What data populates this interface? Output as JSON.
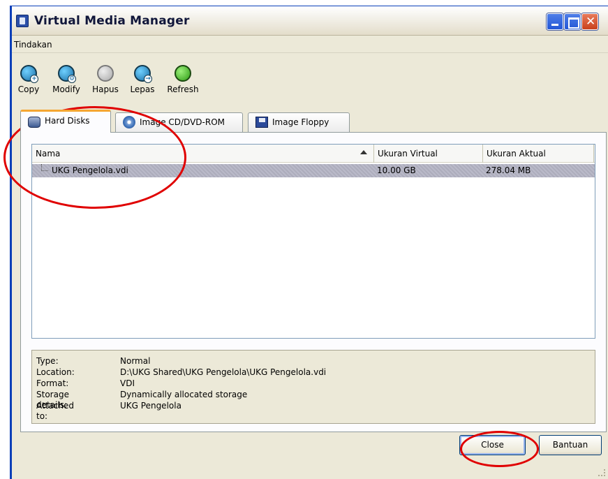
{
  "window": {
    "title": "Virtual Media Manager"
  },
  "menu": {
    "items": [
      "Tindakan"
    ]
  },
  "toolbar": {
    "copy": "Copy",
    "modify": "Modify",
    "hapus": "Hapus",
    "lepas": "Lepas",
    "refresh": "Refresh"
  },
  "tabs": [
    {
      "label": "Hard Disks",
      "icon": "hard-disk-icon",
      "active": true
    },
    {
      "label": "Image CD/DVD-ROM",
      "icon": "cd-dvd-icon",
      "active": false
    },
    {
      "label": "Image Floppy",
      "icon": "floppy-icon",
      "active": false
    }
  ],
  "list": {
    "columns": [
      "Nama",
      "Ukuran Virtual",
      "Ukuran Aktual"
    ],
    "sort_column": "Nama",
    "sort_direction": "ascending",
    "rows": [
      {
        "name": "UKG Pengelola.vdi",
        "virtual_size": "10.00 GB",
        "actual_size": "278.04 MB",
        "selected": true
      }
    ]
  },
  "details": {
    "type_label": "Type:",
    "type_value": "Normal",
    "location_label": "Location:",
    "location_value": "D:\\UKG Shared\\UKG Pengelola\\UKG Pengelola.vdi",
    "format_label": "Format:",
    "format_value": "VDI",
    "storage_label": "Storage details:",
    "storage_value": "Dynamically allocated storage",
    "attached_label": "Attached to:",
    "attached_value": "UKG Pengelola"
  },
  "buttons": {
    "close": "Close",
    "help": "Bantuan"
  },
  "colors": {
    "annotation": "#e00000",
    "selection": "#b6b6c6",
    "tab_accent": "#f5a632"
  }
}
